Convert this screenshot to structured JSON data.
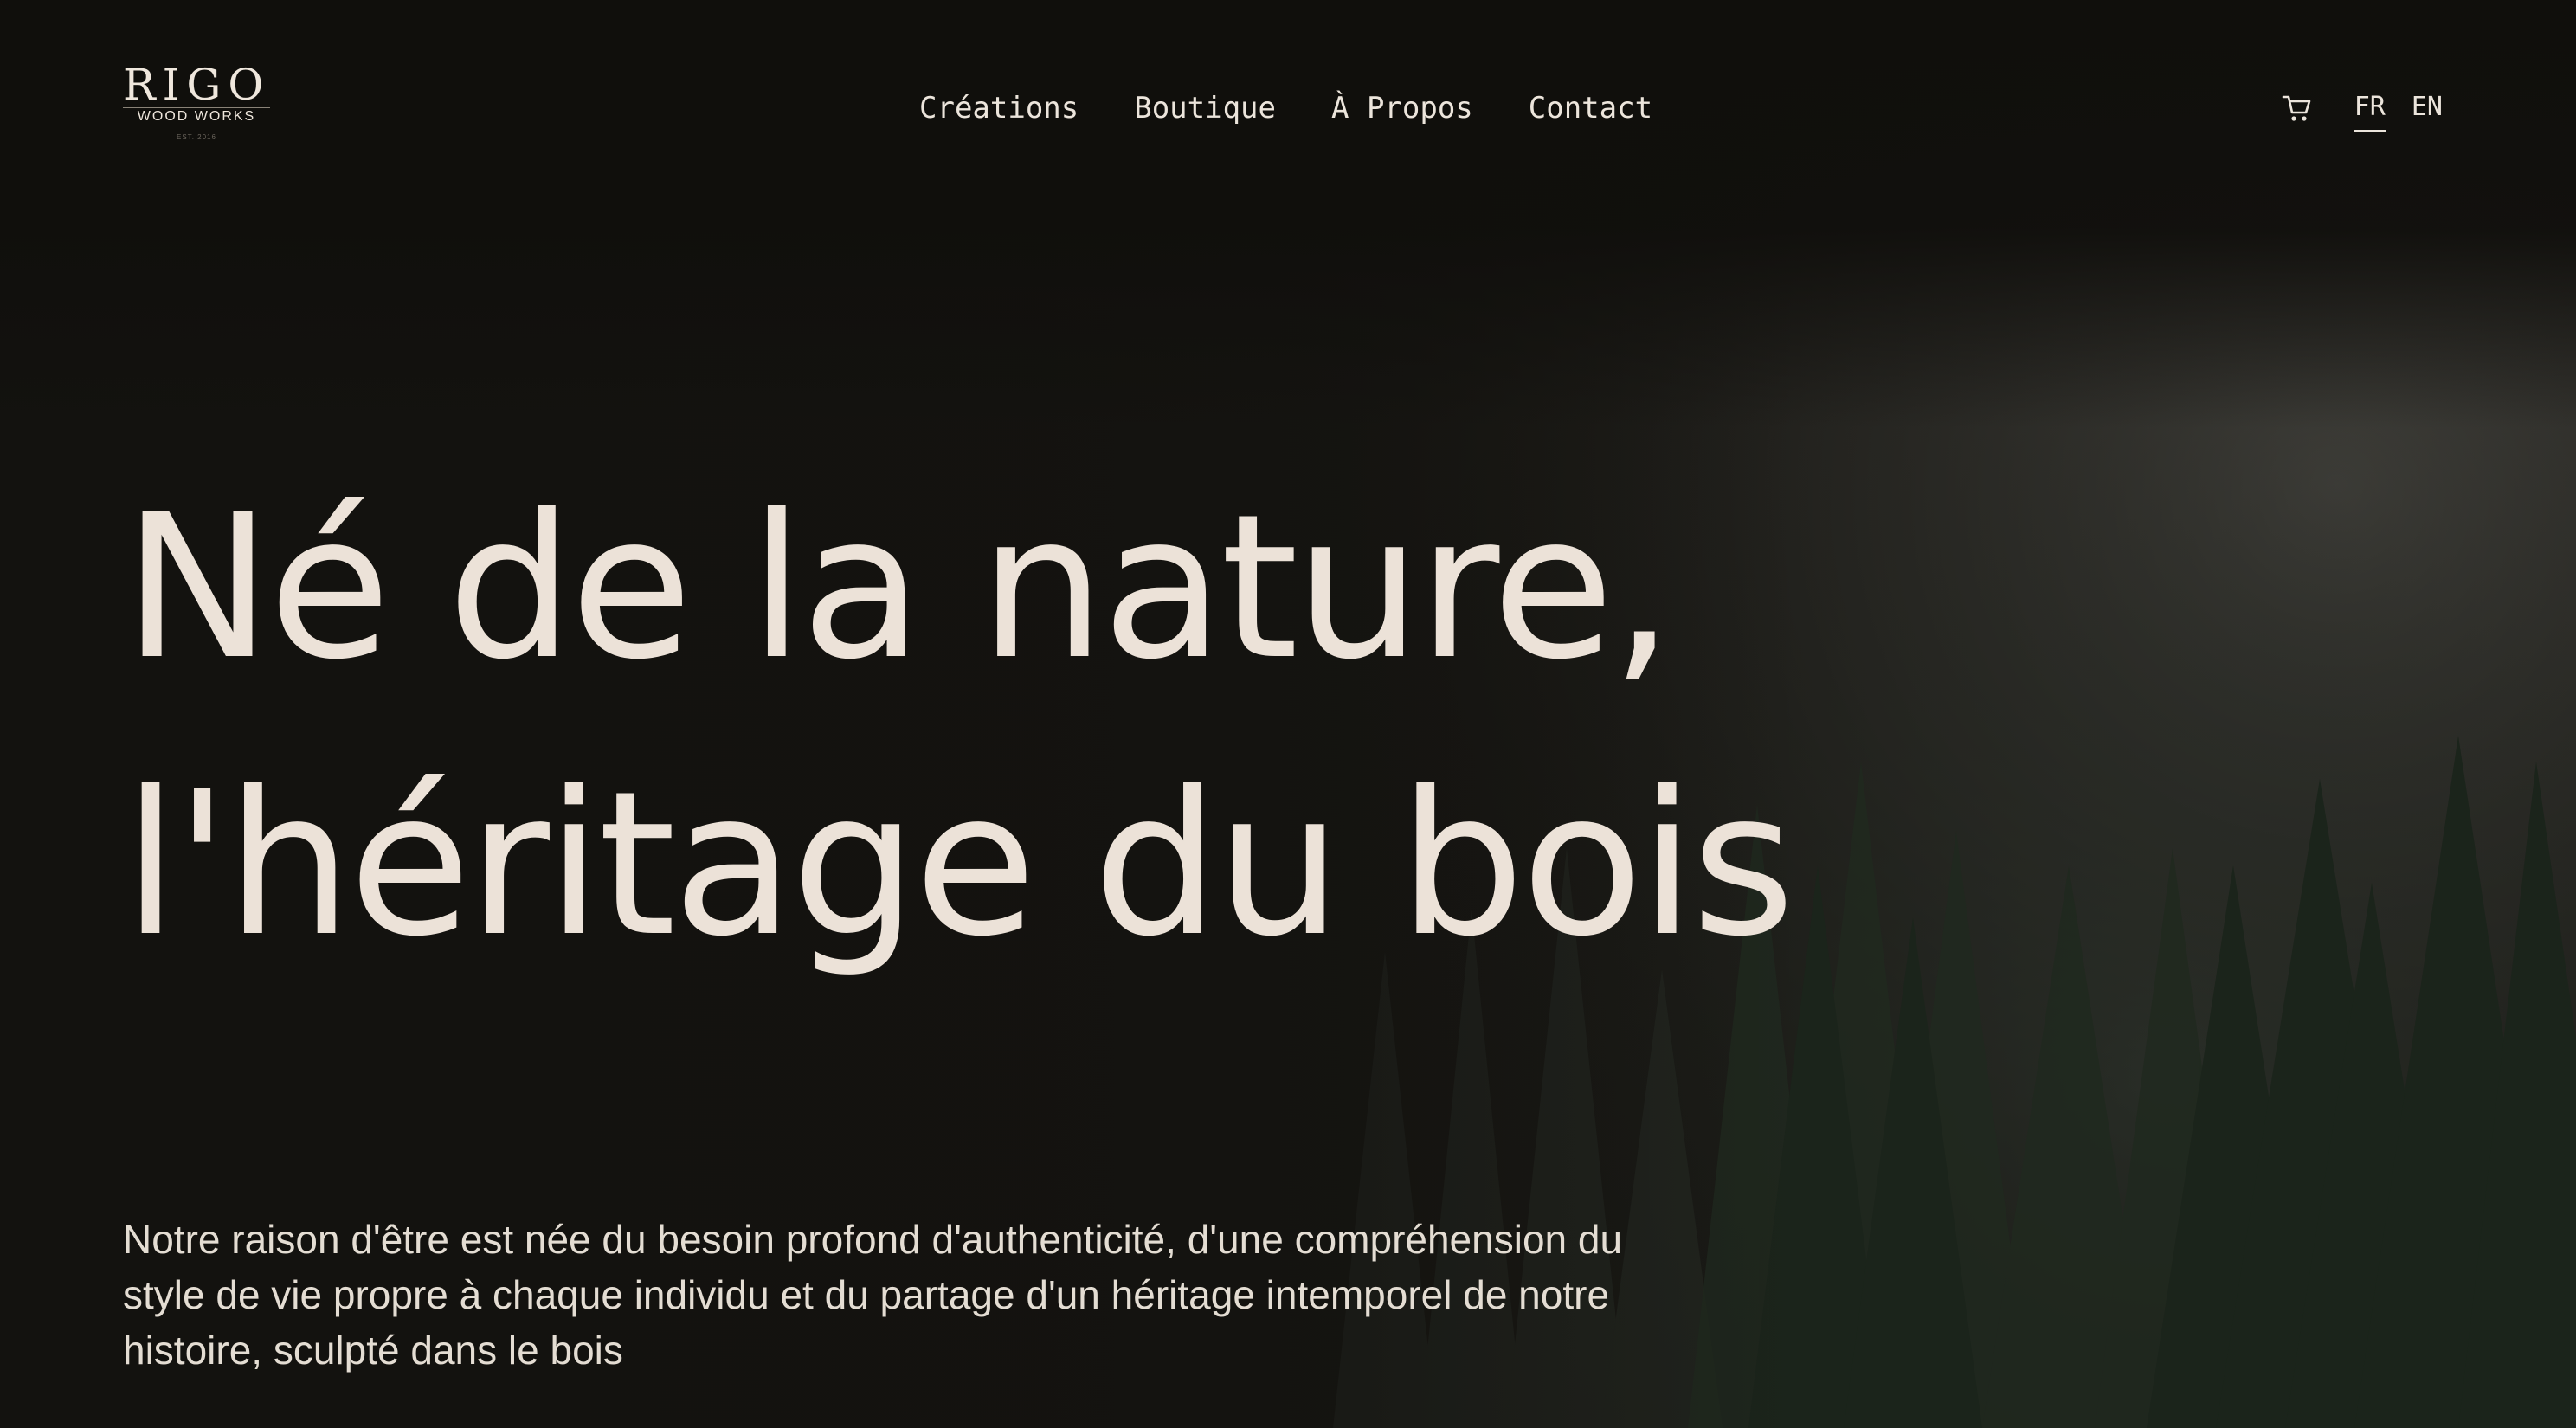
{
  "brand": {
    "name": "RIGO",
    "tagline": "WOOD WORKS",
    "est": "EST. 2016"
  },
  "nav": {
    "items": [
      {
        "label": "Créations"
      },
      {
        "label": "Boutique"
      },
      {
        "label": "À Propos"
      },
      {
        "label": "Contact"
      }
    ]
  },
  "header": {
    "cart_icon": "cart-icon",
    "languages": [
      {
        "code": "FR",
        "active": true
      },
      {
        "code": "EN",
        "active": false
      }
    ]
  },
  "hero": {
    "title_line1": "Né de la nature,",
    "title_line2": "l'héritage du bois",
    "description": "Notre raison d'être est née du besoin profond d'authenticité, d'une compréhension du style de vie propre à chaque individu et du partage d'un héritage intemporel de notre histoire, sculpté dans le bois"
  },
  "colors": {
    "background": "#13120f",
    "text": "#ece2d8",
    "forest": "#1f2a21",
    "fog": "#4a4944"
  }
}
